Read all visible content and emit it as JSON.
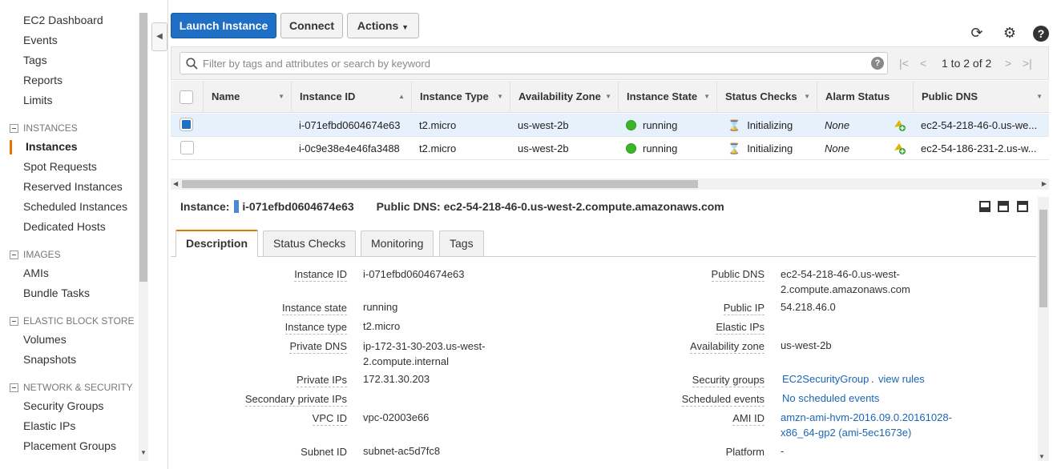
{
  "sidebar": {
    "top_items": [
      "EC2 Dashboard",
      "Events",
      "Tags",
      "Reports",
      "Limits"
    ],
    "sections": [
      {
        "title": "INSTANCES",
        "items": [
          "Instances",
          "Spot Requests",
          "Reserved Instances",
          "Scheduled Instances",
          "Dedicated Hosts"
        ]
      },
      {
        "title": "IMAGES",
        "items": [
          "AMIs",
          "Bundle Tasks"
        ]
      },
      {
        "title": "ELASTIC BLOCK STORE",
        "items": [
          "Volumes",
          "Snapshots"
        ]
      },
      {
        "title": "NETWORK & SECURITY",
        "items": [
          "Security Groups",
          "Elastic IPs",
          "Placement Groups"
        ]
      }
    ],
    "active_item": "Instances"
  },
  "toolbar": {
    "launch_label": "Launch Instance",
    "connect_label": "Connect",
    "actions_label": "Actions"
  },
  "filter": {
    "placeholder": "Filter by tags and attributes or search by keyword",
    "pager_text": "1 to 2 of 2"
  },
  "grid": {
    "columns": [
      "Name",
      "Instance ID",
      "Instance Type",
      "Availability Zone",
      "Instance State",
      "Status Checks",
      "Alarm Status",
      "Public DNS"
    ],
    "rows": [
      {
        "selected": true,
        "name": "",
        "instance_id": "i-071efbd0604674e63",
        "type": "t2.micro",
        "az": "us-west-2b",
        "state": "running",
        "status_checks": "Initializing",
        "alarm": "None",
        "dns": "ec2-54-218-46-0.us-we..."
      },
      {
        "selected": false,
        "name": "",
        "instance_id": "i-0c9e38e4e46fa3488",
        "type": "t2.micro",
        "az": "us-west-2b",
        "state": "running",
        "status_checks": "Initializing",
        "alarm": "None",
        "dns": "ec2-54-186-231-2.us-w..."
      }
    ]
  },
  "detail": {
    "instance_label": "Instance:",
    "instance_id": "i-071efbd0604674e63",
    "dns_label": "Public DNS:",
    "dns_value": "ec2-54-218-46-0.us-west-2.compute.amazonaws.com",
    "tabs": [
      "Description",
      "Status Checks",
      "Monitoring",
      "Tags"
    ],
    "left": [
      {
        "label": "Instance ID",
        "value": "i-071efbd0604674e63"
      },
      {
        "label": "Instance state",
        "value": "running"
      },
      {
        "label": "Instance type",
        "value": "t2.micro"
      },
      {
        "label": "Private DNS",
        "value": "ip-172-31-30-203.us-west-2.compute.internal"
      },
      {
        "label": "Private IPs",
        "value": "172.31.30.203"
      },
      {
        "label": "Secondary private IPs",
        "value": ""
      },
      {
        "label": "VPC ID",
        "value": "vpc-02003e66"
      },
      {
        "label": "Subnet ID",
        "value": "subnet-ac5d7fc8"
      }
    ],
    "right": [
      {
        "label": "Public DNS",
        "value": "ec2-54-218-46-0.us-west-2.compute.amazonaws.com"
      },
      {
        "label": "Public IP",
        "value": "54.218.46.0"
      },
      {
        "label": "Elastic IPs",
        "value": ""
      },
      {
        "label": "Availability zone",
        "value": "us-west-2b"
      },
      {
        "label": "Security groups",
        "value": "EC2SecurityGroup",
        "extra": "view rules"
      },
      {
        "label": "Scheduled events",
        "value": "No scheduled events"
      },
      {
        "label": "AMI ID",
        "value": "amzn-ami-hvm-2016.09.0.20161028-x86_64-gp2 (ami-5ec1673e)"
      },
      {
        "label": "Platform",
        "value": "-"
      }
    ]
  },
  "colors": {
    "primary": "#1f6fc5",
    "accent": "#e77600",
    "running": "#3cb528",
    "link": "#1a66b3"
  },
  "icons": [
    "refresh-icon",
    "gear-icon",
    "help-icon",
    "search-icon",
    "hourglass-icon",
    "alarm-add-icon"
  ]
}
